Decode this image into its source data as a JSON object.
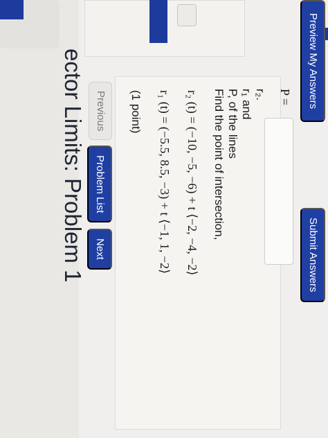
{
  "title": "ector Limits: Problem 1",
  "nav": {
    "previous": "Previous",
    "problem_list": "Problem List",
    "next": "Next"
  },
  "problem": {
    "points": "(1 point)",
    "r1": "r₁(t) = ⟨−5.5, 8.5, −3⟩ + t⟨−1, 1, −2⟩",
    "r1_display": "r₁ (t) = (−5.5, 8.5, −3) + t ⟨−1, 1, −2⟩",
    "r2_display": "r₂ (t) = (−10, −5, −6) + t ⟨−2, −4, −2⟩",
    "question_line1": "Find the point of intersection,",
    "question_line2": "P, of the lines",
    "question_line3": "r₁ and",
    "question_line4": "r₂.",
    "answer_label": "P =",
    "answer_value": ""
  },
  "actions": {
    "preview": "Preview My Answers",
    "submit": "Submit Answers"
  },
  "colors": {
    "accent": "#1f3fa3",
    "background": "#f0efed"
  }
}
